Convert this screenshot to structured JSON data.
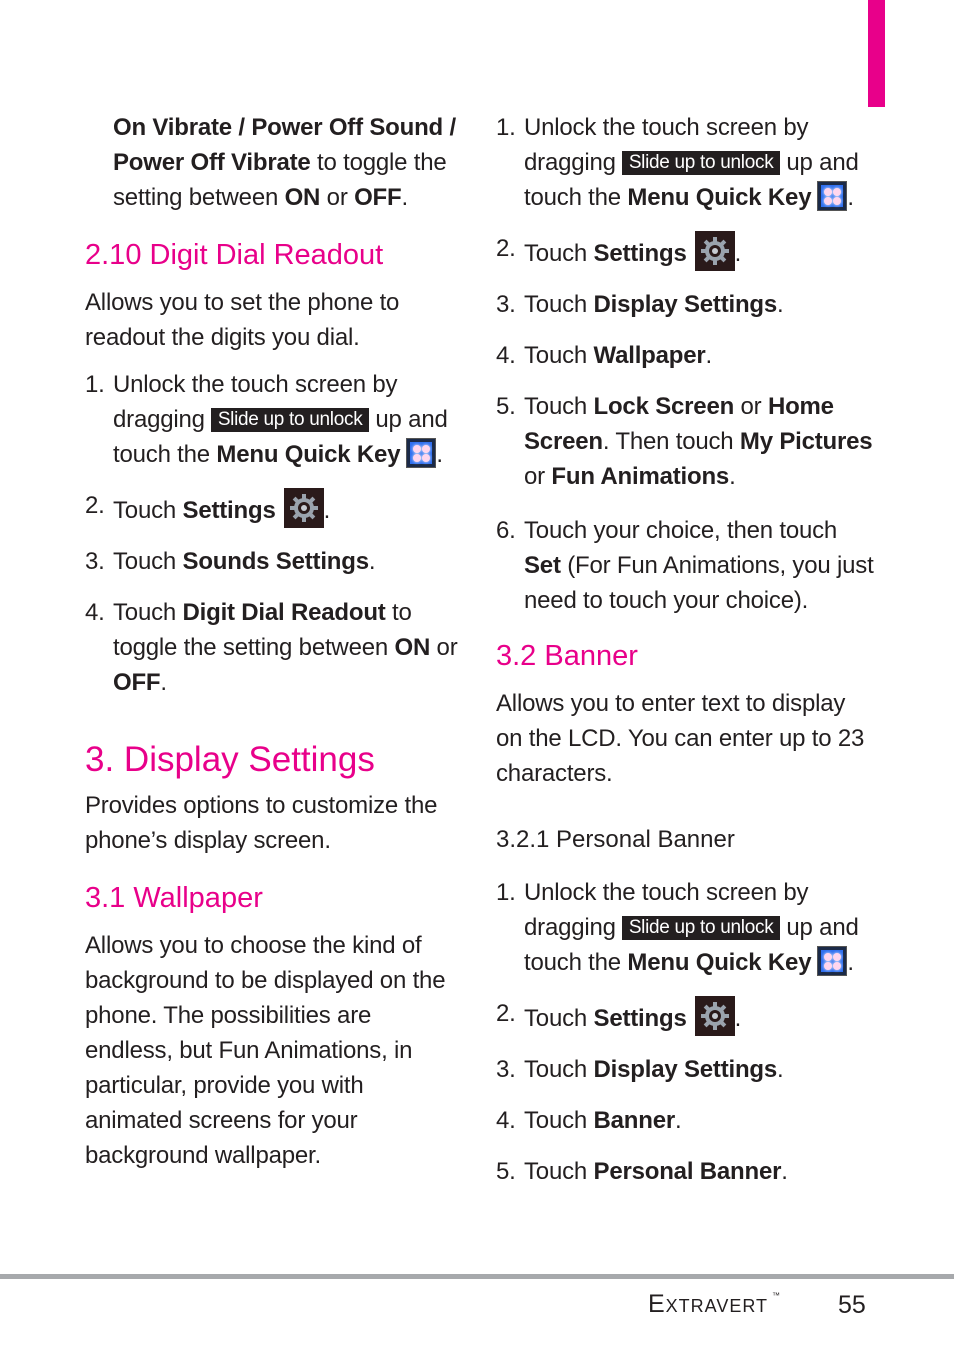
{
  "page": {
    "tab_color": "#e8008a",
    "accent_color": "#e8008a",
    "footer": {
      "brand": "Extravert",
      "trademark": "™",
      "page_number": "55"
    }
  },
  "left": {
    "intro": {
      "bold1": "On Vibrate / Power Off Sound / Power Off Vibrate",
      "text1": " to toggle the setting between ",
      "bold2": "ON",
      "text2": " or ",
      "bold3": "OFF",
      "text3": "."
    },
    "section_210": {
      "heading": "2.10 Digit Dial Readout",
      "desc": "Allows you to set the phone to readout the digits you dial.",
      "steps": [
        {
          "num": "1.",
          "a": "Unlock the touch screen by dragging",
          "slide": "Slide up to unlock",
          "b": "up and touch the ",
          "bold": "Menu Quick Key",
          "end": "."
        },
        {
          "num": "2.",
          "a": "Touch ",
          "bold": "Settings",
          "end": "."
        },
        {
          "num": "3.",
          "a": "Touch ",
          "bold": "Sounds Settings",
          "end": "."
        },
        {
          "num": "4.",
          "a": "Touch ",
          "bold": "Digit Dial Readout",
          "b": " to toggle the setting between ",
          "bold2": "ON",
          "c": " or ",
          "bold3": "OFF",
          "end": "."
        }
      ]
    },
    "section_3": {
      "heading": "3. Display Settings",
      "desc": "Provides options to customize the phone’s display screen."
    },
    "section_31": {
      "heading": "3.1 Wallpaper",
      "desc": "Allows you to choose the kind of background to be displayed on the phone. The possibilities are endless, but Fun Animations, in particular, provide you with animated screens for your background wallpaper."
    }
  },
  "right": {
    "wallpaper_steps": [
      {
        "num": "1.",
        "a": "Unlock the touch screen by dragging",
        "slide": "Slide up to unlock",
        "b": "up and touch the ",
        "bold": "Menu Quick Key",
        "end": "."
      },
      {
        "num": "2.",
        "a": "Touch ",
        "bold": "Settings",
        "end": "."
      },
      {
        "num": "3.",
        "a": "Touch ",
        "bold": "Display Settings",
        "end": "."
      },
      {
        "num": "4.",
        "a": "Touch ",
        "bold": "Wallpaper",
        "end": "."
      },
      {
        "num": "5.",
        "a": "Touch ",
        "bold": "Lock Screen",
        "b": " or ",
        "bold2": "Home Screen",
        "c": ". Then touch ",
        "bold3": "My Pictures",
        "d": " or ",
        "bold4": "Fun Animations",
        "end": "."
      },
      {
        "num": "6.",
        "a": "Touch your choice, then touch ",
        "bold": "Set",
        "b": " (For Fun Animations, you just need to touch your choice)."
      }
    ],
    "section_32": {
      "heading": "3.2 Banner",
      "desc": "Allows you to enter text to display on the LCD. You can enter up to 23 characters."
    },
    "section_321": {
      "heading": "3.2.1 Personal Banner",
      "steps": [
        {
          "num": "1.",
          "a": "Unlock the touch screen by dragging",
          "slide": "Slide up to unlock",
          "b": "up and touch the ",
          "bold": "Menu Quick Key",
          "end": "."
        },
        {
          "num": "2.",
          "a": "Touch ",
          "bold": "Settings",
          "end": "."
        },
        {
          "num": "3.",
          "a": "Touch ",
          "bold": "Display Settings",
          "end": "."
        },
        {
          "num": "4.",
          "a": "Touch ",
          "bold": "Banner",
          "end": "."
        },
        {
          "num": "5.",
          "a": "Touch ",
          "bold": "Personal Banner",
          "end": "."
        }
      ]
    }
  }
}
